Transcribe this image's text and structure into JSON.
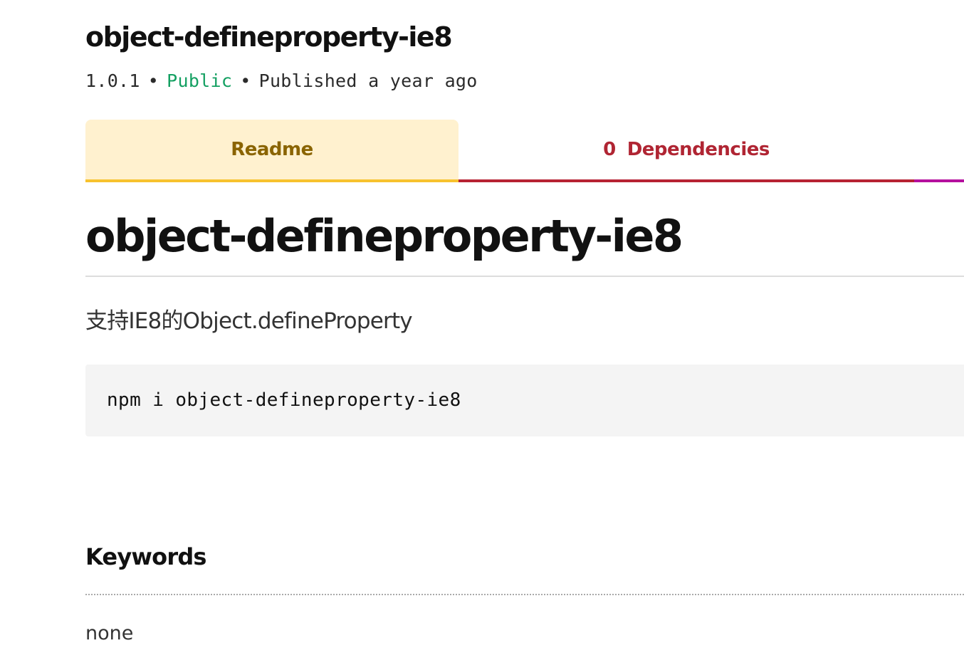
{
  "package": {
    "name": "object-defineproperty-ie8",
    "version": "1.0.1",
    "separator": "•",
    "visibility": "Public",
    "published": "Published a year ago"
  },
  "tabs": {
    "readme_label": "Readme",
    "dependencies_count": "0",
    "dependencies_label": "Dependencies"
  },
  "readme": {
    "heading": "object-defineproperty-ie8",
    "description": "支持IE8的Object.defineProperty",
    "install_command": "npm i object-defineproperty-ie8"
  },
  "keywords": {
    "heading": "Keywords",
    "value": "none"
  },
  "colors": {
    "public_green": "#14a062",
    "readme_tab_bg": "#fff1cf",
    "readme_tab_text": "#8a6400",
    "readme_tab_bar": "#f7c22e",
    "deps_tab_text": "#b02533",
    "deps_tab_bar": "#b72233",
    "extra_tab_bar": "#b5109e"
  }
}
